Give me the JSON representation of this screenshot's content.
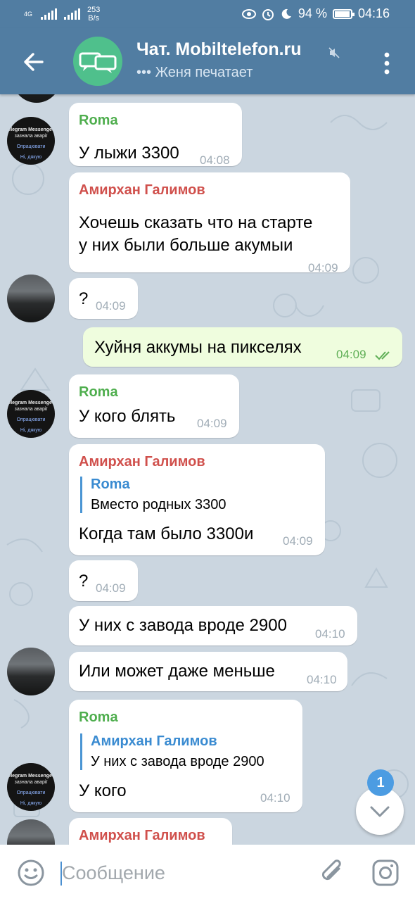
{
  "status_bar": {
    "network": "4G",
    "speed": "253",
    "speed_unit": "B/s",
    "battery": "94 %",
    "battery_level": 0.94,
    "time": "04:16"
  },
  "header": {
    "title": "Чат. Mobiltelefon.ru",
    "subtitle": "••• Женя печатает"
  },
  "messages": [
    {
      "sender": "Roma",
      "text": "У лыжи 3300",
      "time": "04:08"
    },
    {
      "sender": "Амирхан Галимов",
      "text": "Хочешь сказать что на старте",
      "text2": "у них были больше акумыи",
      "time": "04:09"
    },
    {
      "text": "?",
      "time": "04:09"
    },
    {
      "text": "Хуйня аккумы на пикселях",
      "time": "04:09"
    },
    {
      "sender": "Roma",
      "text": "У кого блять",
      "time": "04:09"
    },
    {
      "sender": "Амирхан Галимов",
      "quote_sender": "Roma",
      "quote_text": "Вместо родных 3300",
      "text": "Когда там было 3300и",
      "time": "04:09"
    },
    {
      "text": "?",
      "time": "04:09"
    },
    {
      "text": "У них с завода вроде 2900",
      "time": "04:10"
    },
    {
      "text": "Или может даже меньше",
      "time": "04:10"
    },
    {
      "sender": "Roma",
      "quote_sender": "Амирхан Галимов",
      "quote_text": "У них с завода вроде 2900",
      "text": "У кого",
      "time": "04:10"
    },
    {
      "sender": "Амирхан Галимов"
    }
  ],
  "avatar_tg": {
    "line1": "elegram Messenger",
    "line2": "зазнала аварії",
    "line3": "Опрацювати",
    "line4": "Ні, дякую"
  },
  "input": {
    "placeholder": "Сообщение"
  },
  "unread_count": "1",
  "colors": {
    "header": "#517da2",
    "outgoing": "#effdde",
    "accent": "#4c9ce2",
    "roma": "#4fae4e",
    "amirkhan": "#d0504c"
  }
}
